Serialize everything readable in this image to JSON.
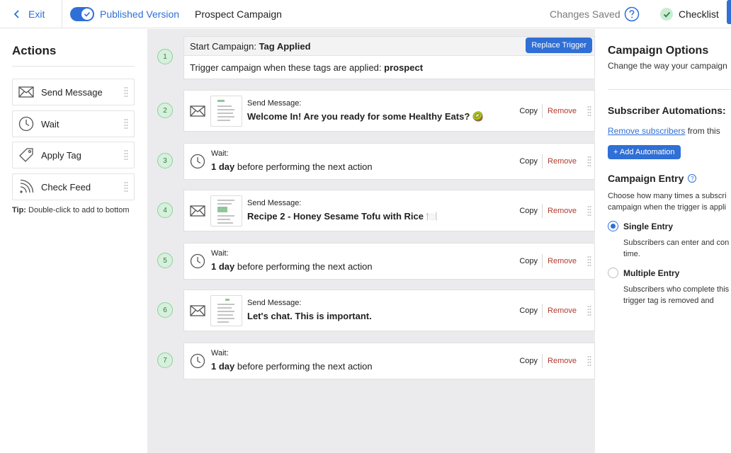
{
  "topbar": {
    "exit_label": "Exit",
    "version_label": "Published Version",
    "campaign_name": "Prospect Campaign",
    "save_status": "Changes Saved",
    "checklist_label": "Checklist"
  },
  "sidebar": {
    "title": "Actions",
    "items": [
      {
        "label": "Send Message",
        "icon": "envelope-icon"
      },
      {
        "label": "Wait",
        "icon": "clock-icon"
      },
      {
        "label": "Apply Tag",
        "icon": "tag-icon"
      },
      {
        "label": "Check Feed",
        "icon": "rss-icon"
      }
    ],
    "tip_bold": "Tip:",
    "tip_text": " Double-click to add to bottom"
  },
  "trigger": {
    "step": "1",
    "head_prefix": "Start Campaign: ",
    "head_bold": "Tag Applied",
    "replace_label": "Replace Trigger",
    "body_prefix": "Trigger campaign when these tags are applied: ",
    "body_tag": "prospect"
  },
  "steps": [
    {
      "num": "2",
      "kind": "message",
      "label": "Send Message:",
      "title": "Welcome In! Are you ready for some Healthy Eats? 🥝"
    },
    {
      "num": "3",
      "kind": "wait",
      "label": "Wait:",
      "amount": "1 day",
      "rest": " before performing the next action"
    },
    {
      "num": "4",
      "kind": "message",
      "label": "Send Message:",
      "title": "Recipe 2 - Honey Sesame Tofu with Rice 🍽️"
    },
    {
      "num": "5",
      "kind": "wait",
      "label": "Wait:",
      "amount": "1 day",
      "rest": " before performing the next action"
    },
    {
      "num": "6",
      "kind": "message",
      "label": "Send Message:",
      "title": "Let's chat. This is important."
    },
    {
      "num": "7",
      "kind": "wait",
      "label": "Wait:",
      "amount": "1 day",
      "rest": " before performing the next action"
    }
  ],
  "row_actions": {
    "copy": "Copy",
    "remove": "Remove"
  },
  "options": {
    "title": "Campaign Options",
    "subtitle": "Change the way your campaign",
    "automations_title": "Subscriber Automations:",
    "remove_link": "Remove subscribers",
    "remove_rest": " from this",
    "add_automation": "+ Add Automation",
    "entry_title": "Campaign Entry",
    "entry_desc": "Choose how many times a subscri campaign when the trigger is appli",
    "single_label": "Single Entry",
    "single_desc": "Subscribers can enter and con time.",
    "multiple_label": "Multiple Entry",
    "multiple_desc": "Subscribers who complete this the trigger tag is removed and"
  },
  "colors": {
    "accent": "#2f6fd6",
    "remove": "#b03a2e",
    "step_green": "#d6f0dc",
    "canvas": "#ebebed"
  }
}
